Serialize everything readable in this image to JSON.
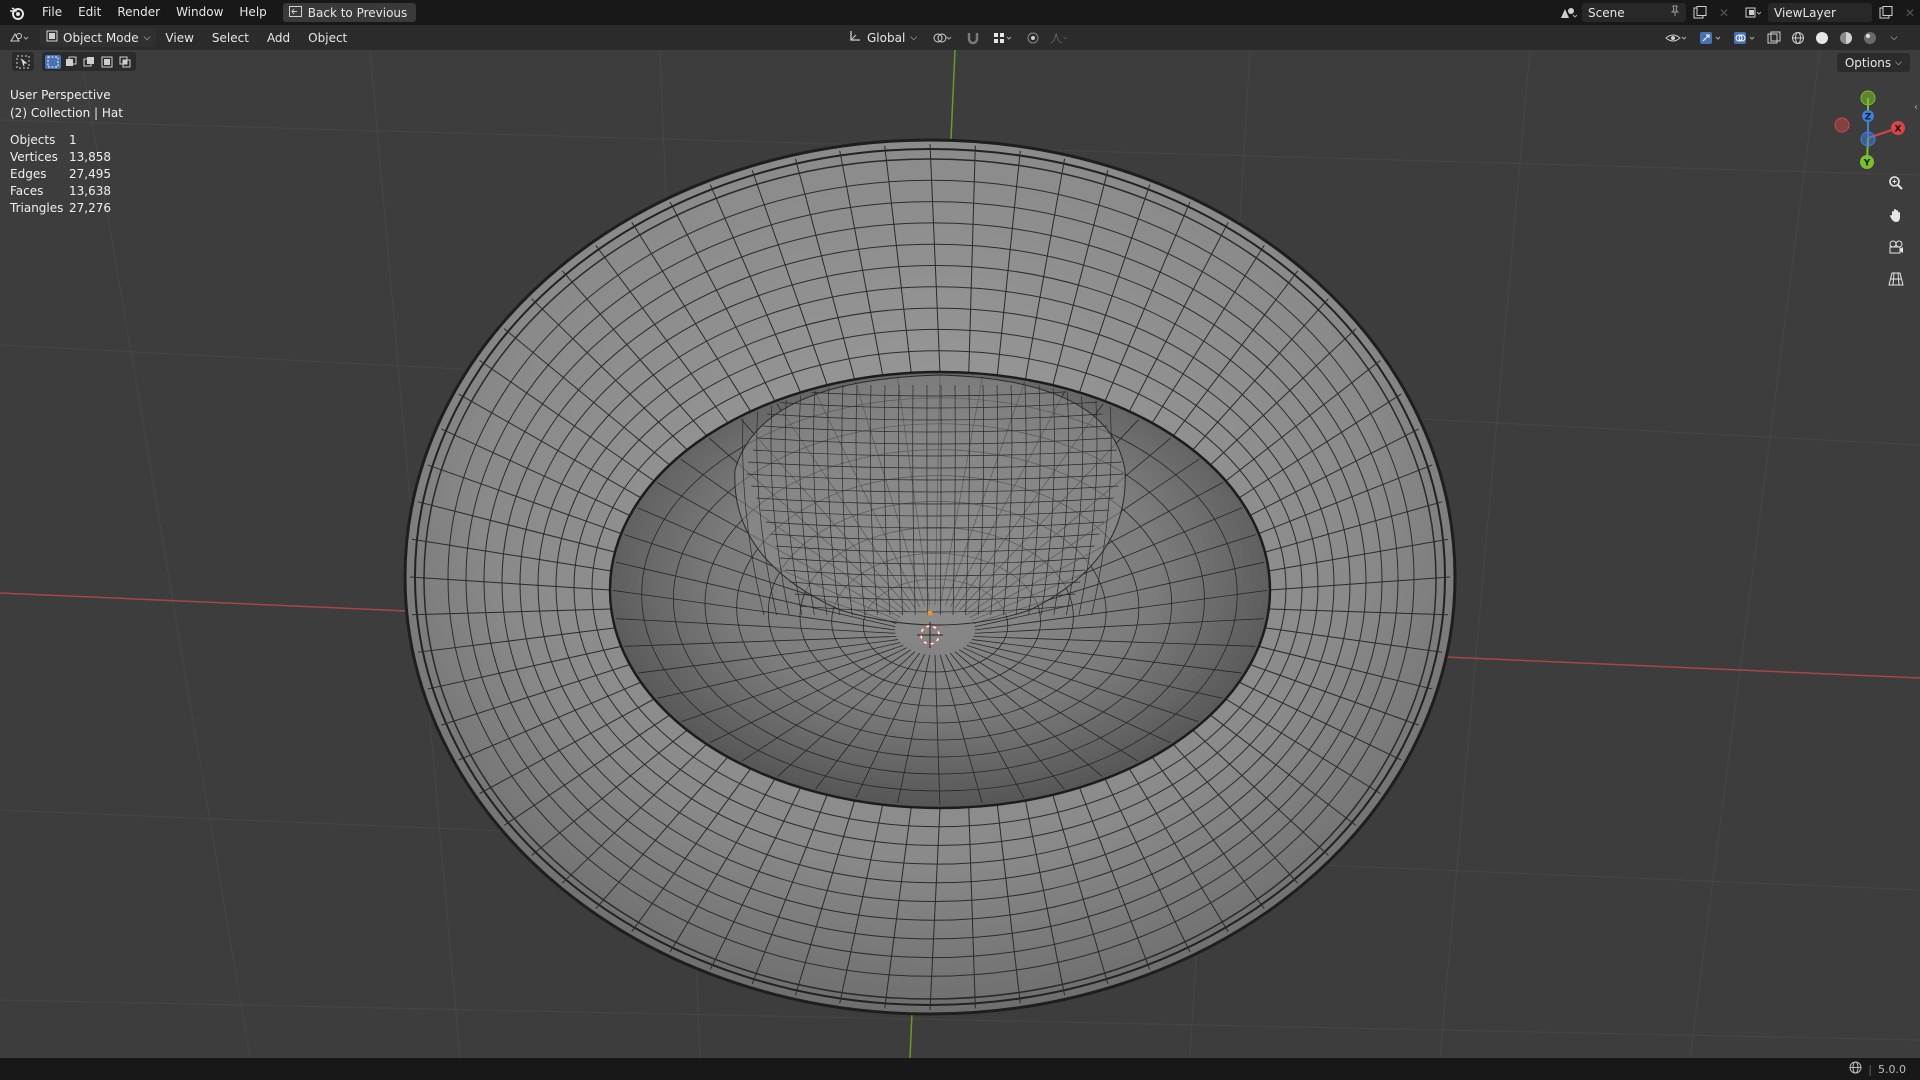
{
  "menu": {
    "items": [
      "File",
      "Edit",
      "Render",
      "Window",
      "Help"
    ],
    "back_button": "Back to Previous"
  },
  "topright": {
    "scene": "Scene",
    "view_layer": "ViewLayer"
  },
  "header": {
    "mode": "Object Mode",
    "menus": [
      "View",
      "Select",
      "Add",
      "Object"
    ],
    "transform_orientation": "Global",
    "options": "Options"
  },
  "viewport": {
    "view_name": "User Perspective",
    "collection": "(2) Collection | Hat",
    "stats": [
      {
        "label": "Objects",
        "value": "1"
      },
      {
        "label": "Vertices",
        "value": "13,858"
      },
      {
        "label": "Edges",
        "value": "27,495"
      },
      {
        "label": "Faces",
        "value": "13,638"
      },
      {
        "label": "Triangles",
        "value": "27,276"
      }
    ],
    "gizmo": {
      "x": "X",
      "y": "Y",
      "z": "Z"
    }
  },
  "status": {
    "version": "5.0.0"
  },
  "colors": {
    "x_axis": "#d34848",
    "y_axis": "#7bbf2a",
    "z_axis": "#3f7fdb",
    "accent": "#4772b3"
  }
}
